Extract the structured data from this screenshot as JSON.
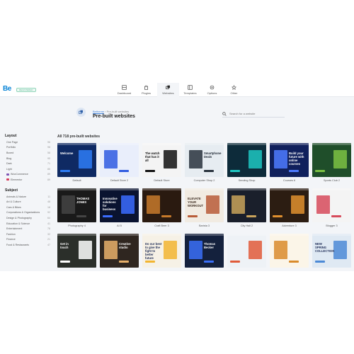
{
  "header": {
    "logo": "Be",
    "badge": "REGISTERED",
    "nav": [
      {
        "label": "Dashboard",
        "icon": "dashboard-icon"
      },
      {
        "label": "Plugins",
        "icon": "plugin-icon"
      },
      {
        "label": "Websites",
        "icon": "websites-icon",
        "active": true
      },
      {
        "label": "Templates",
        "icon": "templates-icon"
      },
      {
        "label": "Options",
        "icon": "options-icon"
      },
      {
        "label": "Other",
        "icon": "other-icon"
      }
    ]
  },
  "page": {
    "breadcrumb_link": "Betheme",
    "breadcrumb_sep": "›",
    "breadcrumb_current": "Pre-built websites",
    "title": "Pre-built websites",
    "search_placeholder": "Search for a website",
    "grid_title": "All 718 pre-built websites"
  },
  "sidebar": {
    "layout_heading": "Layout",
    "layout_items": [
      {
        "label": "One Page",
        "count": "96"
      },
      {
        "label": "Portfolio",
        "count": "98"
      },
      {
        "label": "Boxed",
        "count": "58"
      },
      {
        "label": "Blog",
        "count": "95"
      },
      {
        "label": "Dark",
        "count": "71"
      },
      {
        "label": "Light",
        "count": "85"
      },
      {
        "label": "WooCommerce",
        "count": "89",
        "brand_color": "#7f54b3"
      },
      {
        "label": "Elementor",
        "count": "89",
        "brand_color": "#d63e5c"
      }
    ],
    "subject_heading": "Subject",
    "subject_items": [
      {
        "label": "Animals & Nature",
        "count": "11"
      },
      {
        "label": "Art & Culture",
        "count": "48"
      },
      {
        "label": "Cars & Bikes",
        "count": "18"
      },
      {
        "label": "Corporations & Organizations",
        "count": "92"
      },
      {
        "label": "Design & Photography",
        "count": "64"
      },
      {
        "label": "Education & Science",
        "count": "41"
      },
      {
        "label": "Entertainment",
        "count": "78"
      },
      {
        "label": "Fashion",
        "count": "32"
      },
      {
        "label": "Finance",
        "count": "21"
      },
      {
        "label": "Food & Restaurants",
        "count": "47"
      }
    ]
  },
  "sites": [
    {
      "label": "Default",
      "bg": "#0f2a63",
      "fg": "#ffffff",
      "text": "Welcome",
      "accent": "#2e7df6"
    },
    {
      "label": "Default Store 2",
      "bg": "#e9eefb",
      "fg": "#1c2a55",
      "text": "",
      "accent": "#2f5be0"
    },
    {
      "label": "Default Store",
      "bg": "#f4f4f4",
      "fg": "#111111",
      "text": "The watch that has it all",
      "accent": "#111111"
    },
    {
      "label": "Computer Shop 2",
      "bg": "#e6ecf1",
      "fg": "#1b2430",
      "text": "Smartphone Deals",
      "accent": "#28323d"
    },
    {
      "label": "Sending Shop",
      "bg": "#0d2b3a",
      "fg": "#ffffff",
      "text": "",
      "accent": "#1ec7c2"
    },
    {
      "label": "Courses 6",
      "bg": "#10205c",
      "fg": "#ffffff",
      "text": "Build your future with online courses",
      "accent": "#4e7bff"
    },
    {
      "label": "Sports Club 2",
      "bg": "#1f4e2a",
      "fg": "#ffffff",
      "text": "",
      "accent": "#7cc243"
    },
    {
      "label": "Photography 4",
      "bg": "#1a1a1a",
      "fg": "#ffffff",
      "text": "THOMAS JONES",
      "accent": "#444444"
    },
    {
      "label": "AI 5",
      "bg": "#0a1330",
      "fg": "#ffffff",
      "text": "Innovative solutions for business",
      "accent": "#3b6cff"
    },
    {
      "label": "Craft Beer 3",
      "bg": "#2a1a10",
      "fg": "#f3c26b",
      "text": "",
      "accent": "#c77a2b"
    },
    {
      "label": "Barista 3",
      "bg": "#f1ebe2",
      "fg": "#3b2a1f",
      "text": "ELEVATE YOUR WORKOUT",
      "accent": "#b85c38"
    },
    {
      "label": "City Hall 2",
      "bg": "#1a1f2b",
      "fg": "#ffffff",
      "text": "",
      "accent": "#c9a35b"
    },
    {
      "label": "Adventure 3",
      "bg": "#2c1d12",
      "fg": "#ffffff",
      "text": "",
      "accent": "#e0902f"
    },
    {
      "label": "Blogger 3",
      "bg": "#f4f4f4",
      "fg": "#222222",
      "text": "",
      "accent": "#d64a5a"
    },
    {
      "label": "",
      "bg": "#2b2f2a",
      "fg": "#ffffff",
      "text": "Get in touch",
      "accent": "#ffffff"
    },
    {
      "label": "",
      "bg": "#2f2620",
      "fg": "#ffffff",
      "text": "Creative studio",
      "accent": "#e7b06b"
    },
    {
      "label": "",
      "bg": "#f6f1e6",
      "fg": "#1c2a55",
      "text": "Do our best to give the fight to better future",
      "accent": "#f2b531"
    },
    {
      "label": "",
      "bg": "#14213d",
      "fg": "#ffffff",
      "text": "Thomas Becker",
      "accent": "#3a6ff7"
    },
    {
      "label": "",
      "bg": "#eef2f6",
      "fg": "#1c2a55",
      "text": "",
      "accent": "#e05b3a"
    },
    {
      "label": "",
      "bg": "#fbf5e8",
      "fg": "#333333",
      "text": "",
      "accent": "#d98b2b"
    },
    {
      "label": "",
      "bg": "#dfe9f3",
      "fg": "#1c2a55",
      "text": "NEW SPRING COLLECTION",
      "accent": "#4c8ad6"
    }
  ]
}
